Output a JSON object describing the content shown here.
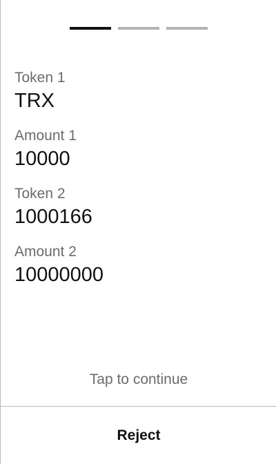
{
  "progress": {
    "total_steps": 3,
    "current_step": 1
  },
  "fields": [
    {
      "label": "Token 1",
      "value": "TRX"
    },
    {
      "label": "Amount 1",
      "value": "10000"
    },
    {
      "label": "Token 2",
      "value": "1000166"
    },
    {
      "label": "Amount 2",
      "value": "10000000"
    }
  ],
  "footer": {
    "tap_hint": "Tap to continue",
    "reject_label": "Reject"
  },
  "colors": {
    "progress_active": "#111111",
    "progress_inactive": "#b3b3b3",
    "label_text": "#6b6b6b",
    "value_text": "#111111"
  }
}
